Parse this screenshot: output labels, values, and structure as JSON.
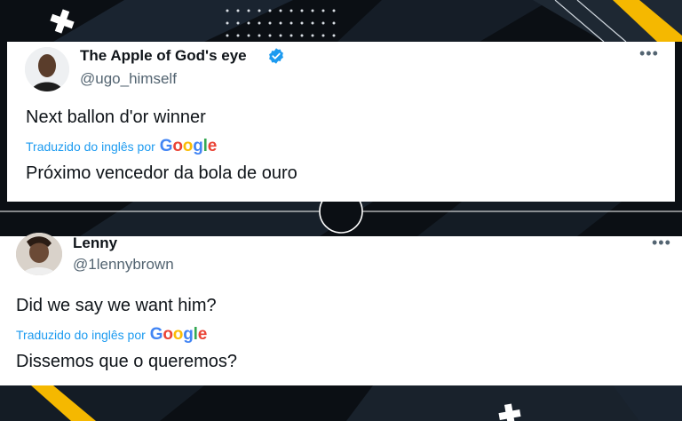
{
  "tweets": [
    {
      "display_name": "The Apple of God's eye",
      "handle": "@ugo_himself",
      "verified": true,
      "text": "Next ballon d'or winner",
      "translated_by_label": "Traduzido do inglês por",
      "translator_brand": "Google",
      "translation": "Próximo vencedor da bola de ouro",
      "more_icon": "more-dots-icon"
    },
    {
      "display_name": "Lenny",
      "handle": "@1lennybrown",
      "verified": false,
      "text": "Did we say we want him?",
      "translated_by_label": "Traduzido do inglês por",
      "translator_brand": "Google",
      "translation": "Dissemos que o queremos?",
      "more_icon": "more-dots-icon"
    }
  ],
  "colors": {
    "background": "#0b0f14",
    "accent_yellow": "#f5b800",
    "link_blue": "#1d9bf0",
    "verified_blue": "#1d9bf0"
  }
}
